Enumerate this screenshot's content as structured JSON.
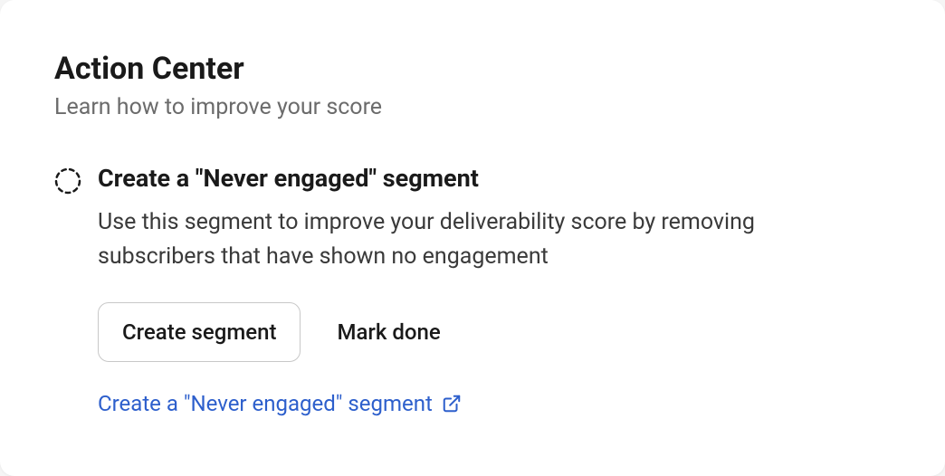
{
  "header": {
    "title": "Action Center",
    "subtitle": "Learn how to improve your score"
  },
  "action": {
    "title": "Create a \"Never engaged\" segment",
    "description": "Use this segment to improve your deliverability score by removing subscribers that have shown no engagement",
    "primary_button": "Create segment",
    "secondary_button": "Mark done",
    "link_text": "Create a \"Never engaged\" segment"
  },
  "colors": {
    "link": "#2d5fcc",
    "text_primary": "#1a1a1a",
    "text_secondary": "#6b6b6b"
  }
}
